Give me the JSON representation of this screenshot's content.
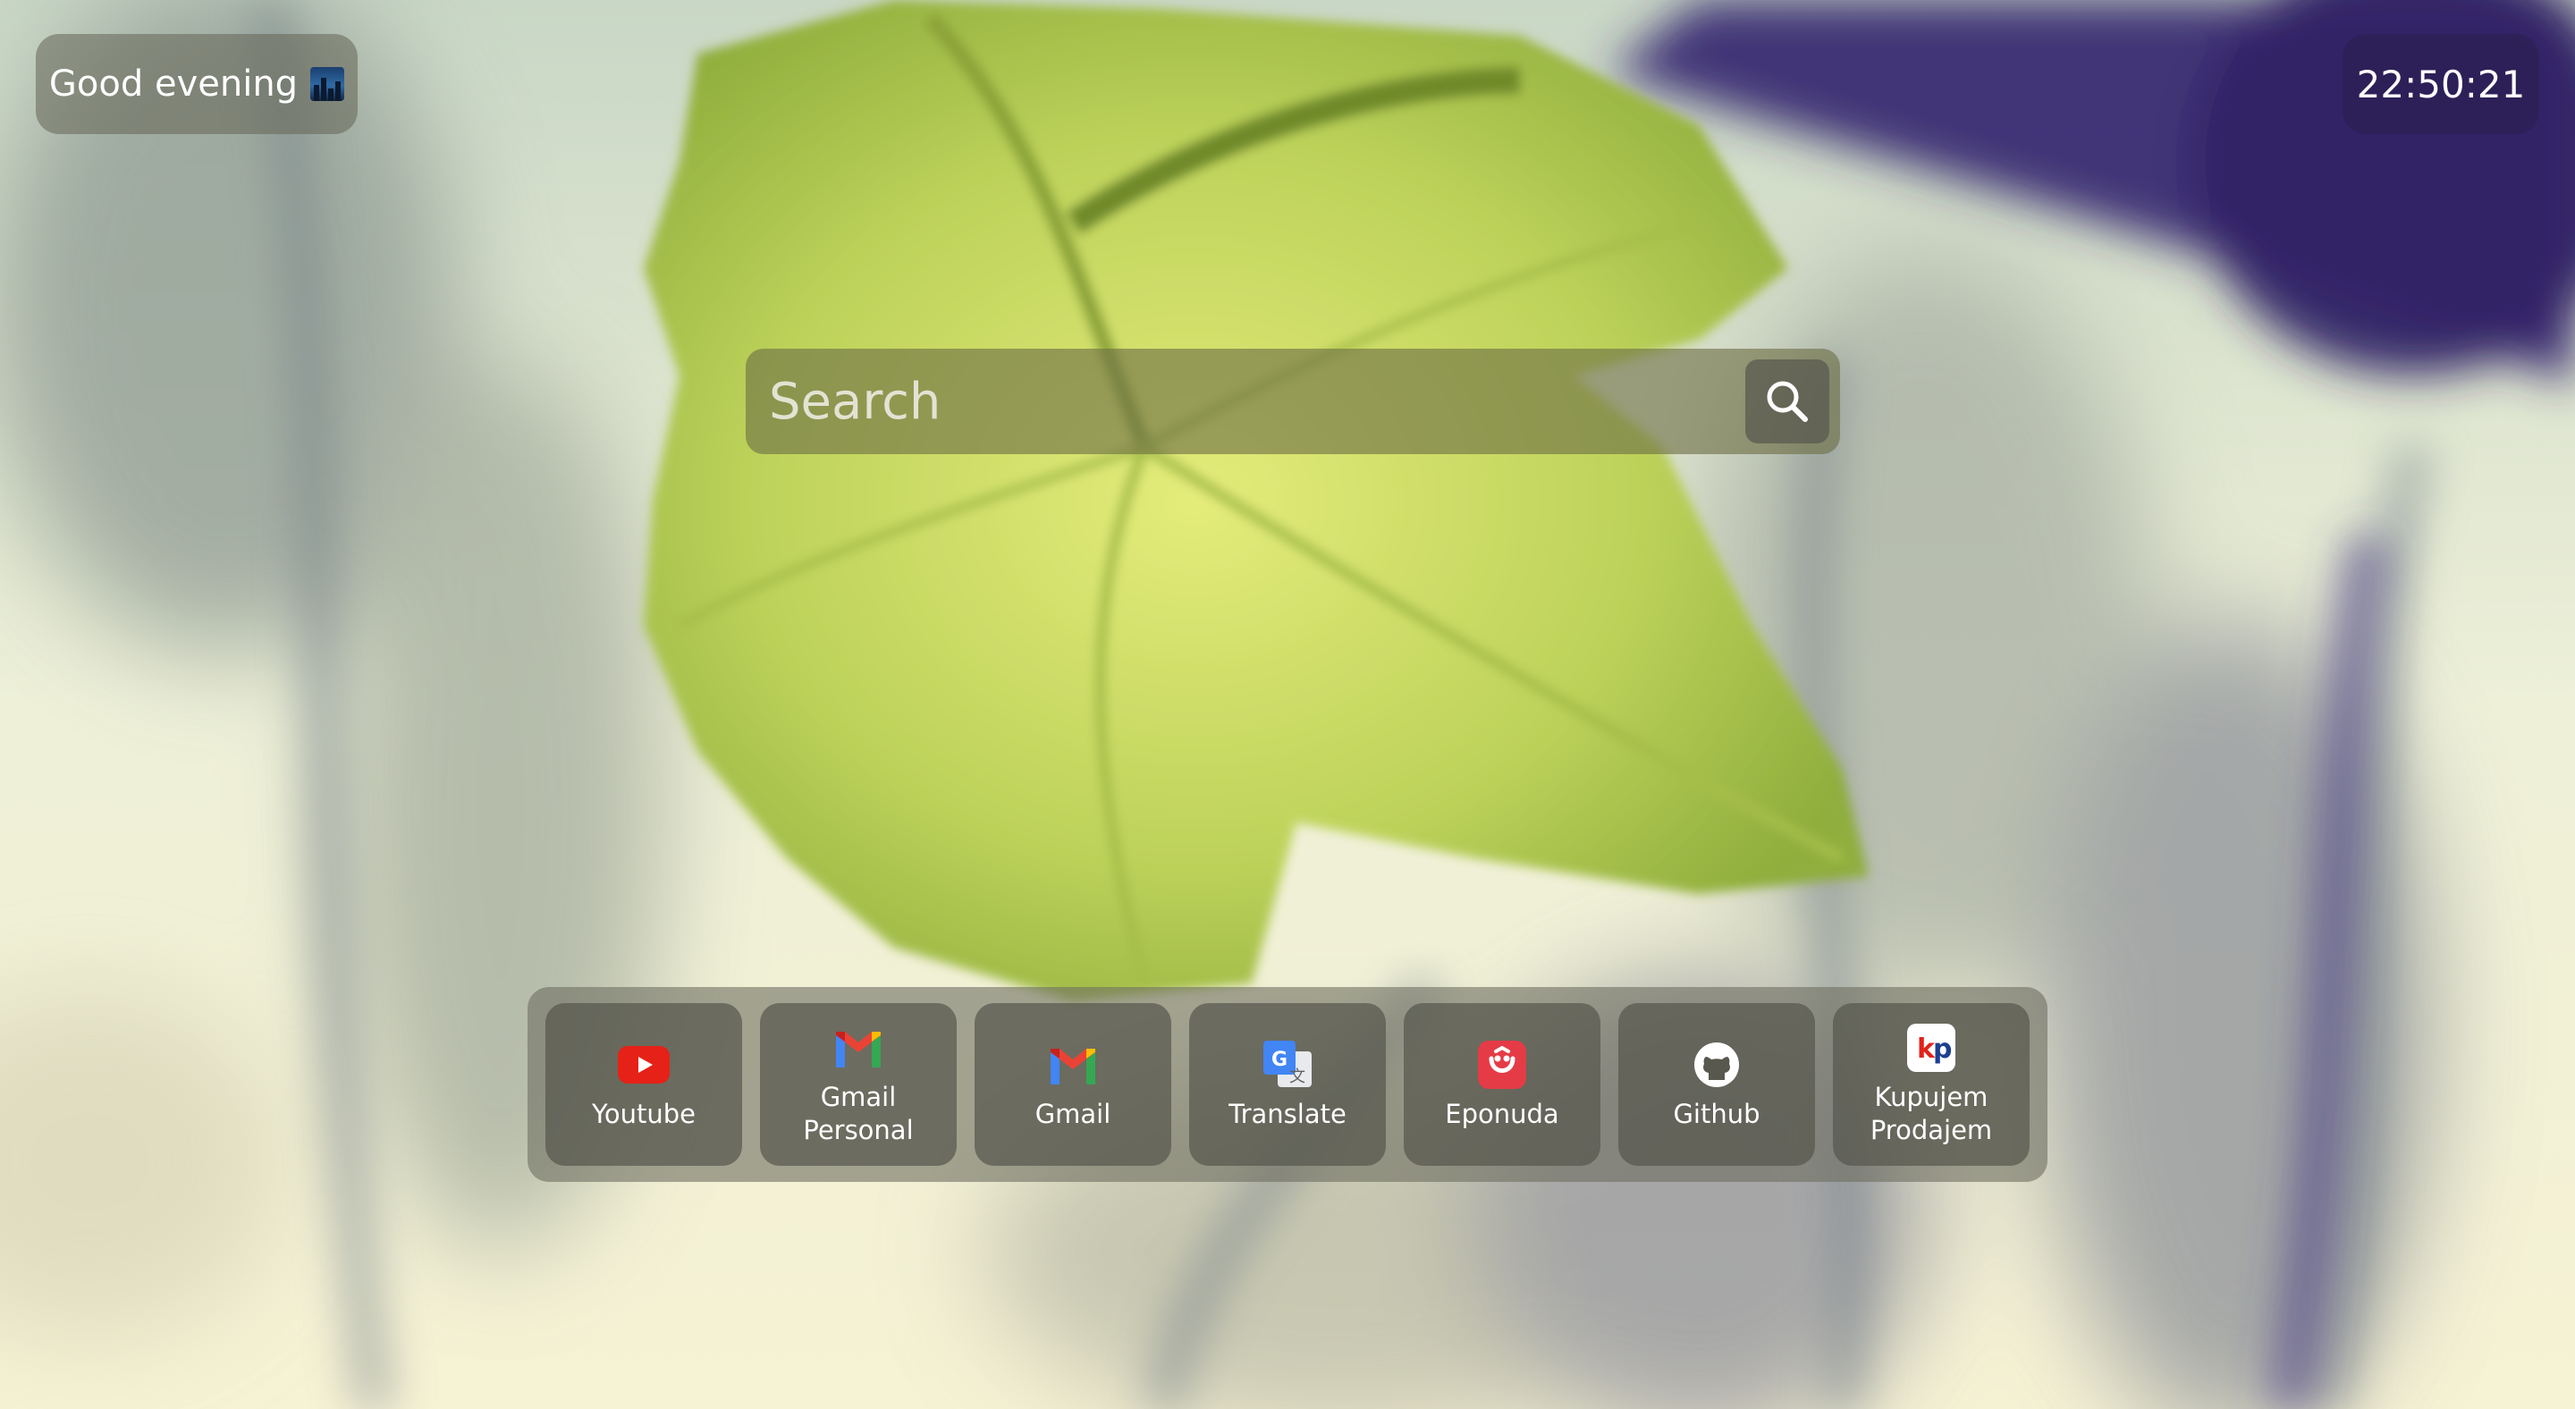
{
  "greeting": {
    "text": "Good evening",
    "icon": "night-city-emoji-icon"
  },
  "clock": {
    "time": "22:50:21"
  },
  "search": {
    "placeholder": "Search",
    "value": "",
    "button_icon": "search-icon"
  },
  "shortcuts": [
    {
      "label": "Youtube",
      "icon": "youtube-icon",
      "color": "#e62117"
    },
    {
      "label": "Gmail\nPersonal",
      "icon": "gmail-icon",
      "color": "#ea4335"
    },
    {
      "label": "Gmail",
      "icon": "gmail-icon",
      "color": "#ea4335"
    },
    {
      "label": "Translate",
      "icon": "google-translate-icon",
      "color": "#4285f4"
    },
    {
      "label": "Eponuda",
      "icon": "eponuda-icon",
      "color": "#e53b46"
    },
    {
      "label": "Github",
      "icon": "github-icon",
      "color": "#ffffff"
    },
    {
      "label": "Kupujem\nProdajem",
      "icon": "kupujem-prodajem-icon",
      "color": "#e2231a"
    }
  ]
}
